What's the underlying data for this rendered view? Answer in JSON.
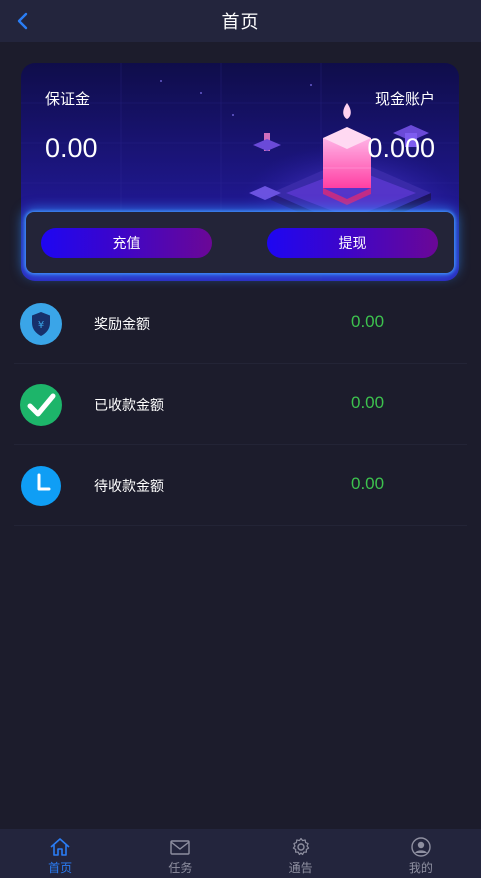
{
  "header": {
    "title": "首页"
  },
  "colors": {
    "header_bg": "#23253d",
    "page_bg": "#1c1c2c",
    "accent_blue": "#2a7df5",
    "value_green": "#3dc24e"
  },
  "card": {
    "deposit_label": "保证金",
    "deposit_value": "0.00",
    "cash_label": "现金账户",
    "cash_value": "0.000"
  },
  "actions": {
    "recharge_label": "充值",
    "withdraw_label": "提现"
  },
  "list": [
    {
      "label": "奖励金额",
      "value": "0.00",
      "icon": "yen-shield-icon"
    },
    {
      "label": "已收款金额",
      "value": "0.00",
      "icon": "check-circle-icon"
    },
    {
      "label": "待收款金额",
      "value": "0.00",
      "icon": "clock-icon"
    }
  ],
  "tabbar": [
    {
      "label": "首页",
      "icon": "home-icon",
      "active": true
    },
    {
      "label": "任务",
      "icon": "mail-icon",
      "active": false
    },
    {
      "label": "通告",
      "icon": "gear-icon",
      "active": false
    },
    {
      "label": "我的",
      "icon": "user-icon",
      "active": false
    }
  ]
}
